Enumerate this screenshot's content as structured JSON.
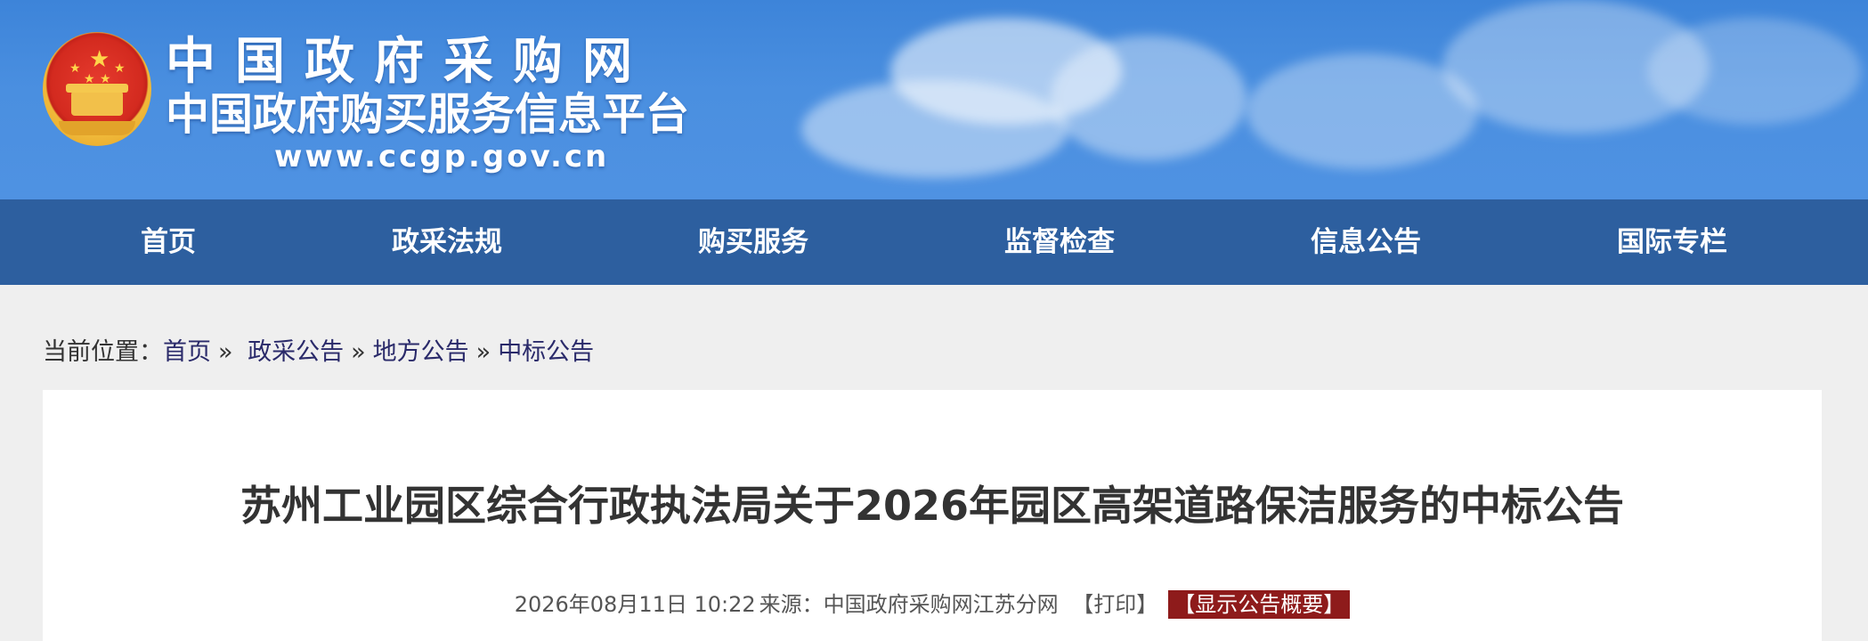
{
  "header": {
    "site_name": "中国政府采购网",
    "site_subtitle": "中国政府购买服务信息平台",
    "site_url": "www.ccgp.gov.cn",
    "brand_color": "#4a8fe0"
  },
  "nav": {
    "items": [
      {
        "label": "首页"
      },
      {
        "label": "政采法规"
      },
      {
        "label": "购买服务"
      },
      {
        "label": "监督检查"
      },
      {
        "label": "信息公告"
      },
      {
        "label": "国际专栏"
      }
    ],
    "background_color": "#2d5f9f"
  },
  "breadcrumb": {
    "prefix": "当前位置：",
    "items": [
      {
        "label": "首页"
      },
      {
        "label": "政采公告"
      },
      {
        "label": "地方公告"
      },
      {
        "label": "中标公告"
      }
    ],
    "separator": "»"
  },
  "article": {
    "title": "苏州工业园区综合行政执法局关于2026年园区高架道路保洁服务的中标公告",
    "datetime": "2026年08月11日 10:22",
    "source_label": "来源：",
    "source": "中国政府采购网江苏分网",
    "print_label": "【打印】",
    "summary_button": "【显示公告概要】",
    "summary_button_color": "#8e1b1b"
  }
}
